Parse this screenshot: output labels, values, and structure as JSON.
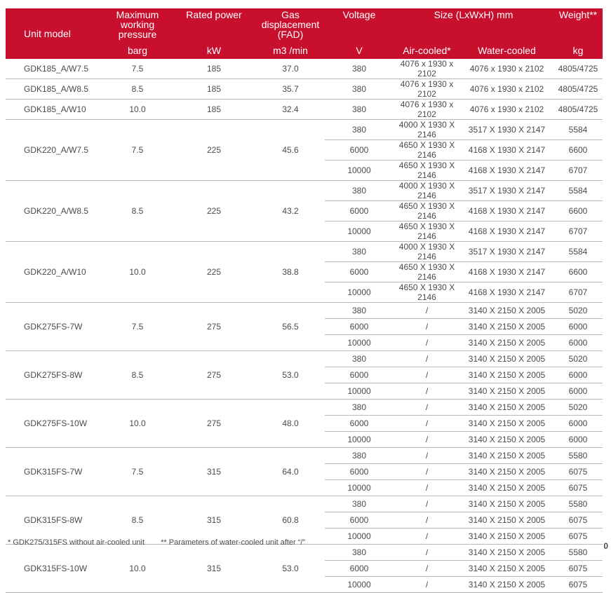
{
  "header": {
    "unit_model": "Unit model",
    "max_pressure": "Maximum working pressure",
    "max_pressure_unit": "barg",
    "rated_power": "Rated power",
    "rated_power_unit": "kW",
    "gas_displacement": "Gas displacement (FAD)",
    "gas_displacement_unit": "m3 /min",
    "voltage": "Voltage",
    "voltage_unit": "V",
    "size": "Size (LxWxH) mm",
    "air_cooled": "Air-cooled*",
    "water_cooled": "Water-cooled",
    "weight": "Weight**",
    "weight_unit": "kg"
  },
  "groups": [
    {
      "model": "GDK185_A/W7.5",
      "pressure": "7.5",
      "power": "185",
      "fad": "37.0",
      "rows": [
        {
          "voltage": "380",
          "air": "4076 x 1930 x 2102",
          "water": "4076 x 1930 x 2102",
          "weight": "4805/4725"
        }
      ]
    },
    {
      "model": "GDK185_A/W8.5",
      "pressure": "8.5",
      "power": "185",
      "fad": "35.7",
      "rows": [
        {
          "voltage": "380",
          "air": "4076 x 1930 x 2102",
          "water": "4076 x 1930 x 2102",
          "weight": "4805/4725"
        }
      ]
    },
    {
      "model": "GDK185_A/W10",
      "pressure": "10.0",
      "power": "185",
      "fad": "32.4",
      "rows": [
        {
          "voltage": "380",
          "air": "4076 x 1930 x 2102",
          "water": "4076 x 1930 x 2102",
          "weight": "4805/4725"
        }
      ]
    },
    {
      "model": "GDK220_A/W7.5",
      "pressure": "7.5",
      "power": "225",
      "fad": "45.6",
      "rows": [
        {
          "voltage": "380",
          "air": "4000 X 1930 X 2146",
          "water": "3517 X 1930 X 2147",
          "weight": "5584"
        },
        {
          "voltage": "6000",
          "air": "4650 X 1930 X 2146",
          "water": "4168 X 1930 X 2147",
          "weight": "6600"
        },
        {
          "voltage": "10000",
          "air": "4650 X 1930 X 2146",
          "water": "4168 X 1930 X 2147",
          "weight": "6707"
        }
      ]
    },
    {
      "model": "GDK220_A/W8.5",
      "pressure": "8.5",
      "power": "225",
      "fad": "43.2",
      "rows": [
        {
          "voltage": "380",
          "air": "4000 X 1930 X 2146",
          "water": "3517 X 1930 X 2147",
          "weight": "5584"
        },
        {
          "voltage": "6000",
          "air": "4650 X 1930 X 2146",
          "water": "4168 X 1930 X 2147",
          "weight": "6600"
        },
        {
          "voltage": "10000",
          "air": "4650 X 1930 X 2146",
          "water": "4168 X 1930 X 2147",
          "weight": "6707"
        }
      ]
    },
    {
      "model": "GDK220_A/W10",
      "pressure": "10.0",
      "power": "225",
      "fad": "38.8",
      "rows": [
        {
          "voltage": "380",
          "air": "4000 X 1930 X 2146",
          "water": "3517 X 1930 X 2147",
          "weight": "5584"
        },
        {
          "voltage": "6000",
          "air": "4650 X 1930 X 2146",
          "water": "4168 X 1930 X 2147",
          "weight": "6600"
        },
        {
          "voltage": "10000",
          "air": "4650 X 1930 X 2146",
          "water": "4168 X 1930 X 2147",
          "weight": "6707"
        }
      ]
    },
    {
      "model": "GDK275FS-7W",
      "pressure": "7.5",
      "power": "275",
      "fad": "56.5",
      "rows": [
        {
          "voltage": "380",
          "air": "/",
          "water": "3140 X 2150 X 2005",
          "weight": "5020"
        },
        {
          "voltage": "6000",
          "air": "/",
          "water": "3140 X 2150 X 2005",
          "weight": "6000"
        },
        {
          "voltage": "10000",
          "air": "/",
          "water": "3140 X 2150 X 2005",
          "weight": "6000"
        }
      ]
    },
    {
      "model": "GDK275FS-8W",
      "pressure": "8.5",
      "power": "275",
      "fad": "53.0",
      "rows": [
        {
          "voltage": "380",
          "air": "/",
          "water": "3140 X 2150 X 2005",
          "weight": "5020"
        },
        {
          "voltage": "6000",
          "air": "/",
          "water": "3140 X 2150 X 2005",
          "weight": "6000"
        },
        {
          "voltage": "10000",
          "air": "/",
          "water": "3140 X 2150 X 2005",
          "weight": "6000"
        }
      ]
    },
    {
      "model": "GDK275FS-10W",
      "pressure": "10.0",
      "power": "275",
      "fad": "48.0",
      "rows": [
        {
          "voltage": "380",
          "air": "/",
          "water": "3140 X 2150 X 2005",
          "weight": "5020"
        },
        {
          "voltage": "6000",
          "air": "/",
          "water": "3140 X 2150 X 2005",
          "weight": "6000"
        },
        {
          "voltage": "10000",
          "air": "/",
          "water": "3140 X 2150 X 2005",
          "weight": "6000"
        }
      ]
    },
    {
      "model": "GDK315FS-7W",
      "pressure": "7.5",
      "power": "315",
      "fad": "64.0",
      "rows": [
        {
          "voltage": "380",
          "air": "/",
          "water": "3140 X 2150 X 2005",
          "weight": "5580"
        },
        {
          "voltage": "6000",
          "air": "/",
          "water": "3140 X 2150 X 2005",
          "weight": "6075"
        },
        {
          "voltage": "10000",
          "air": "/",
          "water": "3140 X 2150 X 2005",
          "weight": "6075"
        }
      ]
    },
    {
      "model": "GDK315FS-8W",
      "pressure": "8.5",
      "power": "315",
      "fad": "60.8",
      "rows": [
        {
          "voltage": "380",
          "air": "/",
          "water": "3140 X 2150 X 2005",
          "weight": "5580"
        },
        {
          "voltage": "6000",
          "air": "/",
          "water": "3140 X 2150 X 2005",
          "weight": "6075"
        },
        {
          "voltage": "10000",
          "air": "/",
          "water": "3140 X 2150 X 2005",
          "weight": "6075"
        }
      ]
    },
    {
      "model": "GDK315FS-10W",
      "pressure": "10.0",
      "power": "315",
      "fad": "53.0",
      "rows": [
        {
          "voltage": "380",
          "air": "/",
          "water": "3140 X 2150 X 2005",
          "weight": "5580"
        },
        {
          "voltage": "6000",
          "air": "/",
          "water": "3140 X 2150 X 2005",
          "weight": "6075"
        },
        {
          "voltage": "10000",
          "air": "/",
          "water": "3140 X 2150 X 2005",
          "weight": "6075"
        }
      ]
    }
  ],
  "footnotes": [
    "* GDK275/315FS without air-cooled unit",
    "** Parameters of water-cooled unit after “/”"
  ],
  "page_number": "0"
}
